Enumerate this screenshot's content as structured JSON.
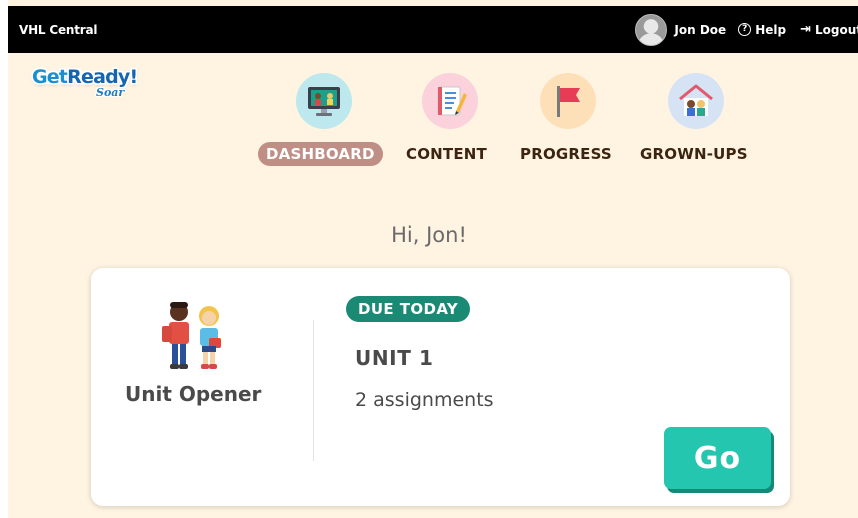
{
  "topbar": {
    "brand": "VHL Central",
    "user_name": "Jon Doe",
    "help_label": "Help",
    "logout_label": "Logout"
  },
  "logo": {
    "get": "Get",
    "ready": "Ready!",
    "sub": "Soar"
  },
  "nav": {
    "items": [
      {
        "label": "DASHBOARD",
        "icon": "dashboard-monitor-icon",
        "active": true
      },
      {
        "label": "CONTENT",
        "icon": "content-notebook-icon",
        "active": false
      },
      {
        "label": "PROGRESS",
        "icon": "progress-flag-icon",
        "active": false
      },
      {
        "label": "GROWN-UPS",
        "icon": "grown-ups-house-icon",
        "active": false
      }
    ]
  },
  "greeting": "Hi, Jon!",
  "card": {
    "unit_opener_label": "Unit Opener",
    "due_badge": "DUE TODAY",
    "unit_title": "UNIT 1",
    "assignments": "2 assignments",
    "go_label": "Go"
  },
  "colors": {
    "page_bg": "#fff4e2",
    "topbar_bg": "#000000",
    "active_nav_pill": "#bf8e84",
    "due_badge": "#1b8a74",
    "go_button": "#24c6b0"
  }
}
